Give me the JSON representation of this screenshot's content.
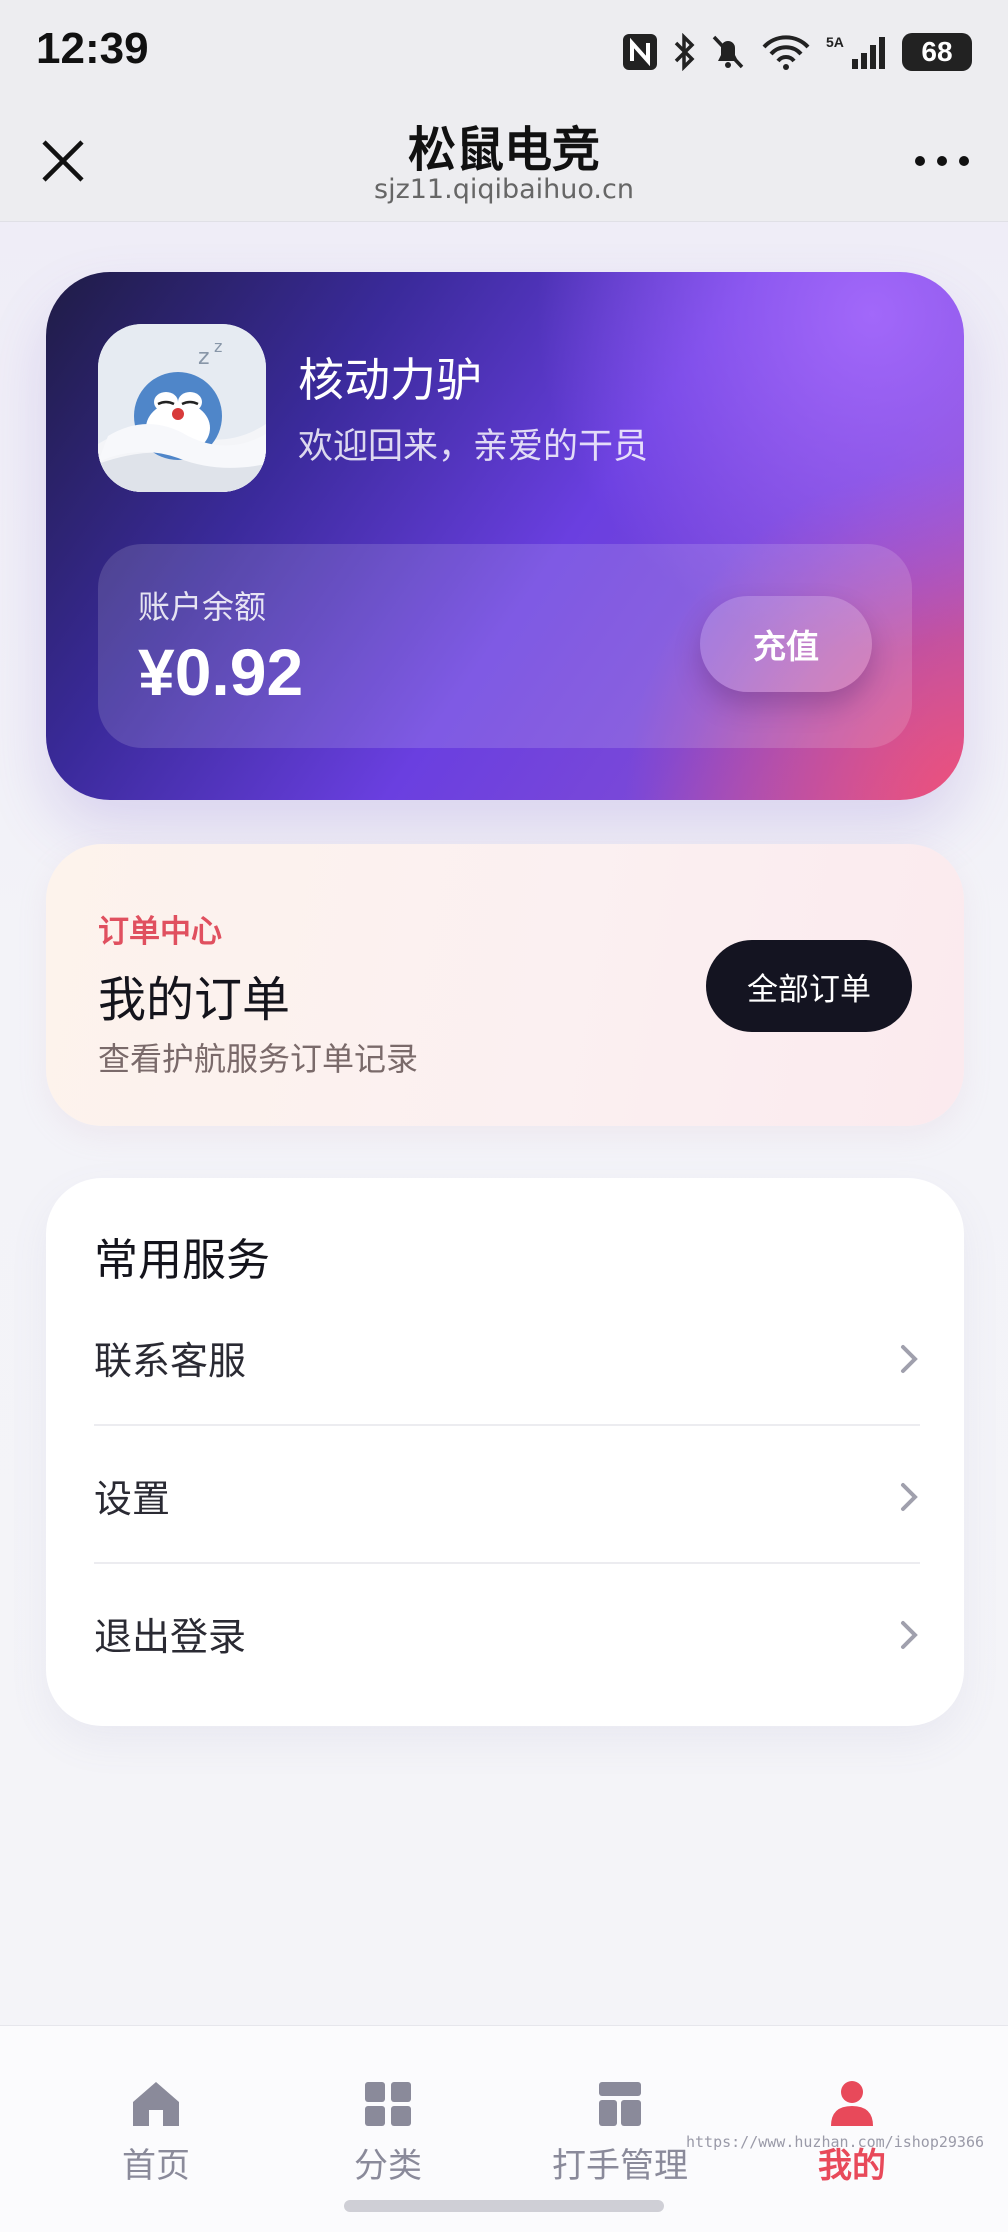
{
  "status_bar": {
    "time": "12:39",
    "battery": "68",
    "icons": [
      "nfc-icon",
      "bluetooth-icon",
      "mute-bell-icon",
      "wifi-icon",
      "signal-5a-icon",
      "battery-icon"
    ]
  },
  "nav": {
    "title": "松鼠电竞",
    "url": "sjz11.qiqibaihuo.cn",
    "close_icon": "close-icon",
    "more_icon": "more-icon"
  },
  "profile": {
    "name": "核动力驴",
    "welcome": "欢迎回来，亲爱的干员",
    "balance_label": "账户余额",
    "balance_value": "¥0.92",
    "recharge_label": "充值"
  },
  "orders": {
    "tag": "订单中心",
    "title": "我的订单",
    "desc": "查看护航服务订单记录",
    "all_orders_label": "全部订单"
  },
  "services": {
    "title": "常用服务",
    "items": [
      {
        "label": "联系客服"
      },
      {
        "label": "设置"
      },
      {
        "label": "退出登录"
      }
    ]
  },
  "tabs": [
    {
      "label": "首页",
      "icon": "home-icon"
    },
    {
      "label": "分类",
      "icon": "grid-icon"
    },
    {
      "label": "打手管理",
      "icon": "layout-icon"
    },
    {
      "label": "我的",
      "icon": "user-icon",
      "active": true
    }
  ],
  "watermark": "https://www.huzhan.com/ishop29366",
  "colors": {
    "accent": "#e8495a",
    "dark_button": "#141421",
    "card_purple": "#6a3fe0"
  }
}
